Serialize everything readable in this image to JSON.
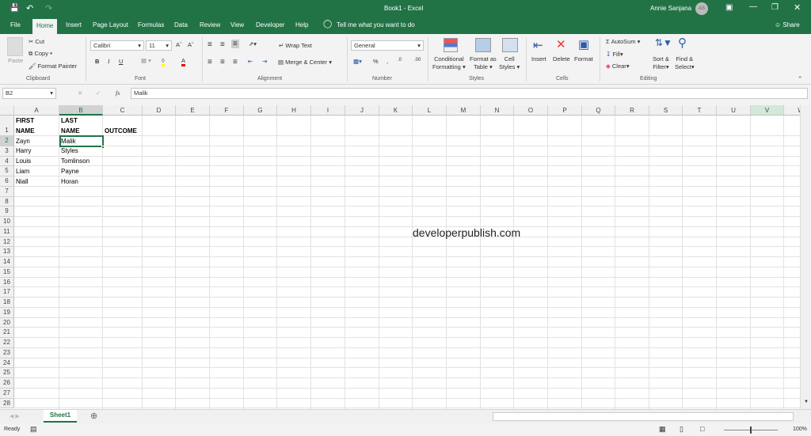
{
  "title": {
    "doc": "Book1 - Excel",
    "user": "Annie Sanjana",
    "initials": "AS"
  },
  "tabs": [
    "File",
    "Home",
    "Insert",
    "Page Layout",
    "Formulas",
    "Data",
    "Review",
    "View",
    "Developer",
    "Help"
  ],
  "tell_me": "Tell me what you want to do",
  "share": "Share",
  "ribbon": {
    "clipboard": {
      "paste": "Paste",
      "cut": "Cut",
      "copy": "Copy",
      "format_painter": "Format Painter",
      "label": "Clipboard"
    },
    "font": {
      "name": "Calibri",
      "size": "11",
      "bold": "B",
      "italic": "I",
      "underline": "U",
      "label": "Font"
    },
    "alignment": {
      "wrap": "Wrap Text",
      "merge": "Merge & Center",
      "label": "Alignment"
    },
    "number": {
      "format": "General",
      "percent": "%",
      "comma": ",",
      "label": "Number"
    },
    "styles": {
      "cond1": "Conditional",
      "cond2": "Formatting",
      "fat1": "Format as",
      "fat2": "Table",
      "cs1": "Cell",
      "cs2": "Styles",
      "label": "Styles"
    },
    "cells": {
      "insert": "Insert",
      "delete": "Delete",
      "format": "Format",
      "label": "Cells"
    },
    "editing": {
      "autosum": "AutoSum",
      "fill": "Fill",
      "clear": "Clear",
      "sort1": "Sort &",
      "sort2": "Filter",
      "find1": "Find &",
      "find2": "Select",
      "label": "Editing"
    }
  },
  "formula_bar": {
    "name_box": "B2",
    "fx": "fx",
    "value": "Malik"
  },
  "columns": [
    "A",
    "B",
    "C",
    "D",
    "E",
    "F",
    "G",
    "H",
    "I",
    "J",
    "K",
    "L",
    "M",
    "N",
    "O",
    "P",
    "Q",
    "R",
    "S",
    "T",
    "U",
    "V",
    "W"
  ],
  "selected_cell": "B2",
  "cells": {
    "A1a": "FIRST",
    "A1b": "NAME",
    "B1a": "LAST",
    "B1b": "NAME",
    "C1": "OUTCOME",
    "rows": [
      [
        "Zayn",
        "Malik"
      ],
      [
        "Harry",
        "Styles"
      ],
      [
        "Louis",
        "Tomlinson"
      ],
      [
        "Liam",
        "Payne"
      ],
      [
        "Niall",
        "Horan"
      ]
    ]
  },
  "watermark": "developerpublish.com",
  "sheet_tab": "Sheet1",
  "status": {
    "ready": "Ready",
    "zoom": "100%"
  },
  "colors": {
    "accent": "#217346"
  }
}
